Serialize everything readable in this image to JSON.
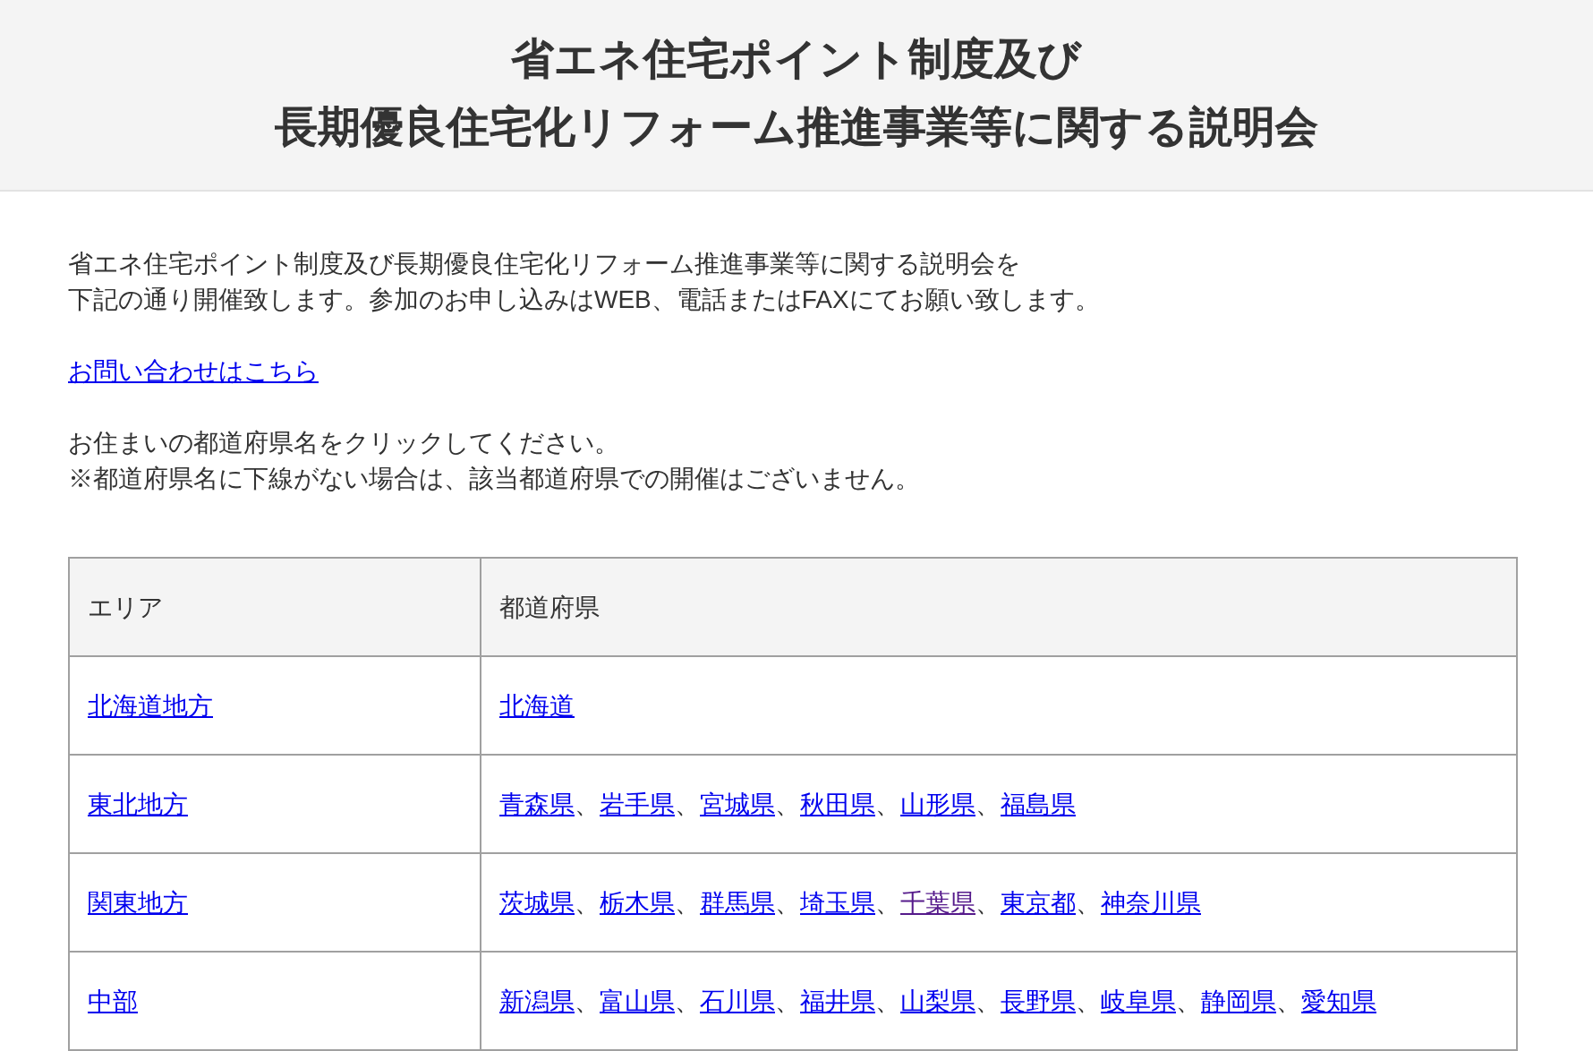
{
  "header": {
    "title_lines": [
      "省エネ住宅ポイント制度及び",
      "長期優良住宅化リフォーム推進事業等に関する説明会"
    ]
  },
  "intro": [
    "省エネ住宅ポイント制度及び長期優良住宅化リフォーム推進事業等に関する説明会を",
    "下記の通り開催致します。参加のお申し込みはWEB、電話またはFAXにてお願い致します。"
  ],
  "contact_link": "お問い合わせはこちら",
  "instructions": [
    "お住まいの都道府県名をクリックしてください。",
    "※都道府県名に下線がない場合は、該当都道府県での開催はございません。"
  ],
  "table": {
    "columns": [
      "エリア",
      "都道府県"
    ],
    "separator": "、",
    "rows": [
      {
        "area": "北海道地方",
        "prefectures": [
          {
            "name": "北海道",
            "visited": false
          }
        ]
      },
      {
        "area": "東北地方",
        "prefectures": [
          {
            "name": "青森県",
            "visited": false
          },
          {
            "name": "岩手県",
            "visited": false
          },
          {
            "name": "宮城県",
            "visited": false
          },
          {
            "name": "秋田県",
            "visited": false
          },
          {
            "name": "山形県",
            "visited": false
          },
          {
            "name": "福島県",
            "visited": false
          }
        ]
      },
      {
        "area": "関東地方",
        "prefectures": [
          {
            "name": "茨城県",
            "visited": false
          },
          {
            "name": "栃木県",
            "visited": false
          },
          {
            "name": "群馬県",
            "visited": false
          },
          {
            "name": "埼玉県",
            "visited": false
          },
          {
            "name": "千葉県",
            "visited": true
          },
          {
            "name": "東京都",
            "visited": false
          },
          {
            "name": "神奈川県",
            "visited": false
          }
        ]
      },
      {
        "area": "中部",
        "prefectures": [
          {
            "name": "新潟県",
            "visited": false
          },
          {
            "name": "富山県",
            "visited": false
          },
          {
            "name": "石川県",
            "visited": false
          },
          {
            "name": "福井県",
            "visited": false
          },
          {
            "name": "山梨県",
            "visited": false
          },
          {
            "name": "長野県",
            "visited": false
          },
          {
            "name": "岐阜県",
            "visited": false
          },
          {
            "name": "静岡県",
            "visited": false
          },
          {
            "name": "愛知県",
            "visited": false
          }
        ]
      }
    ]
  }
}
